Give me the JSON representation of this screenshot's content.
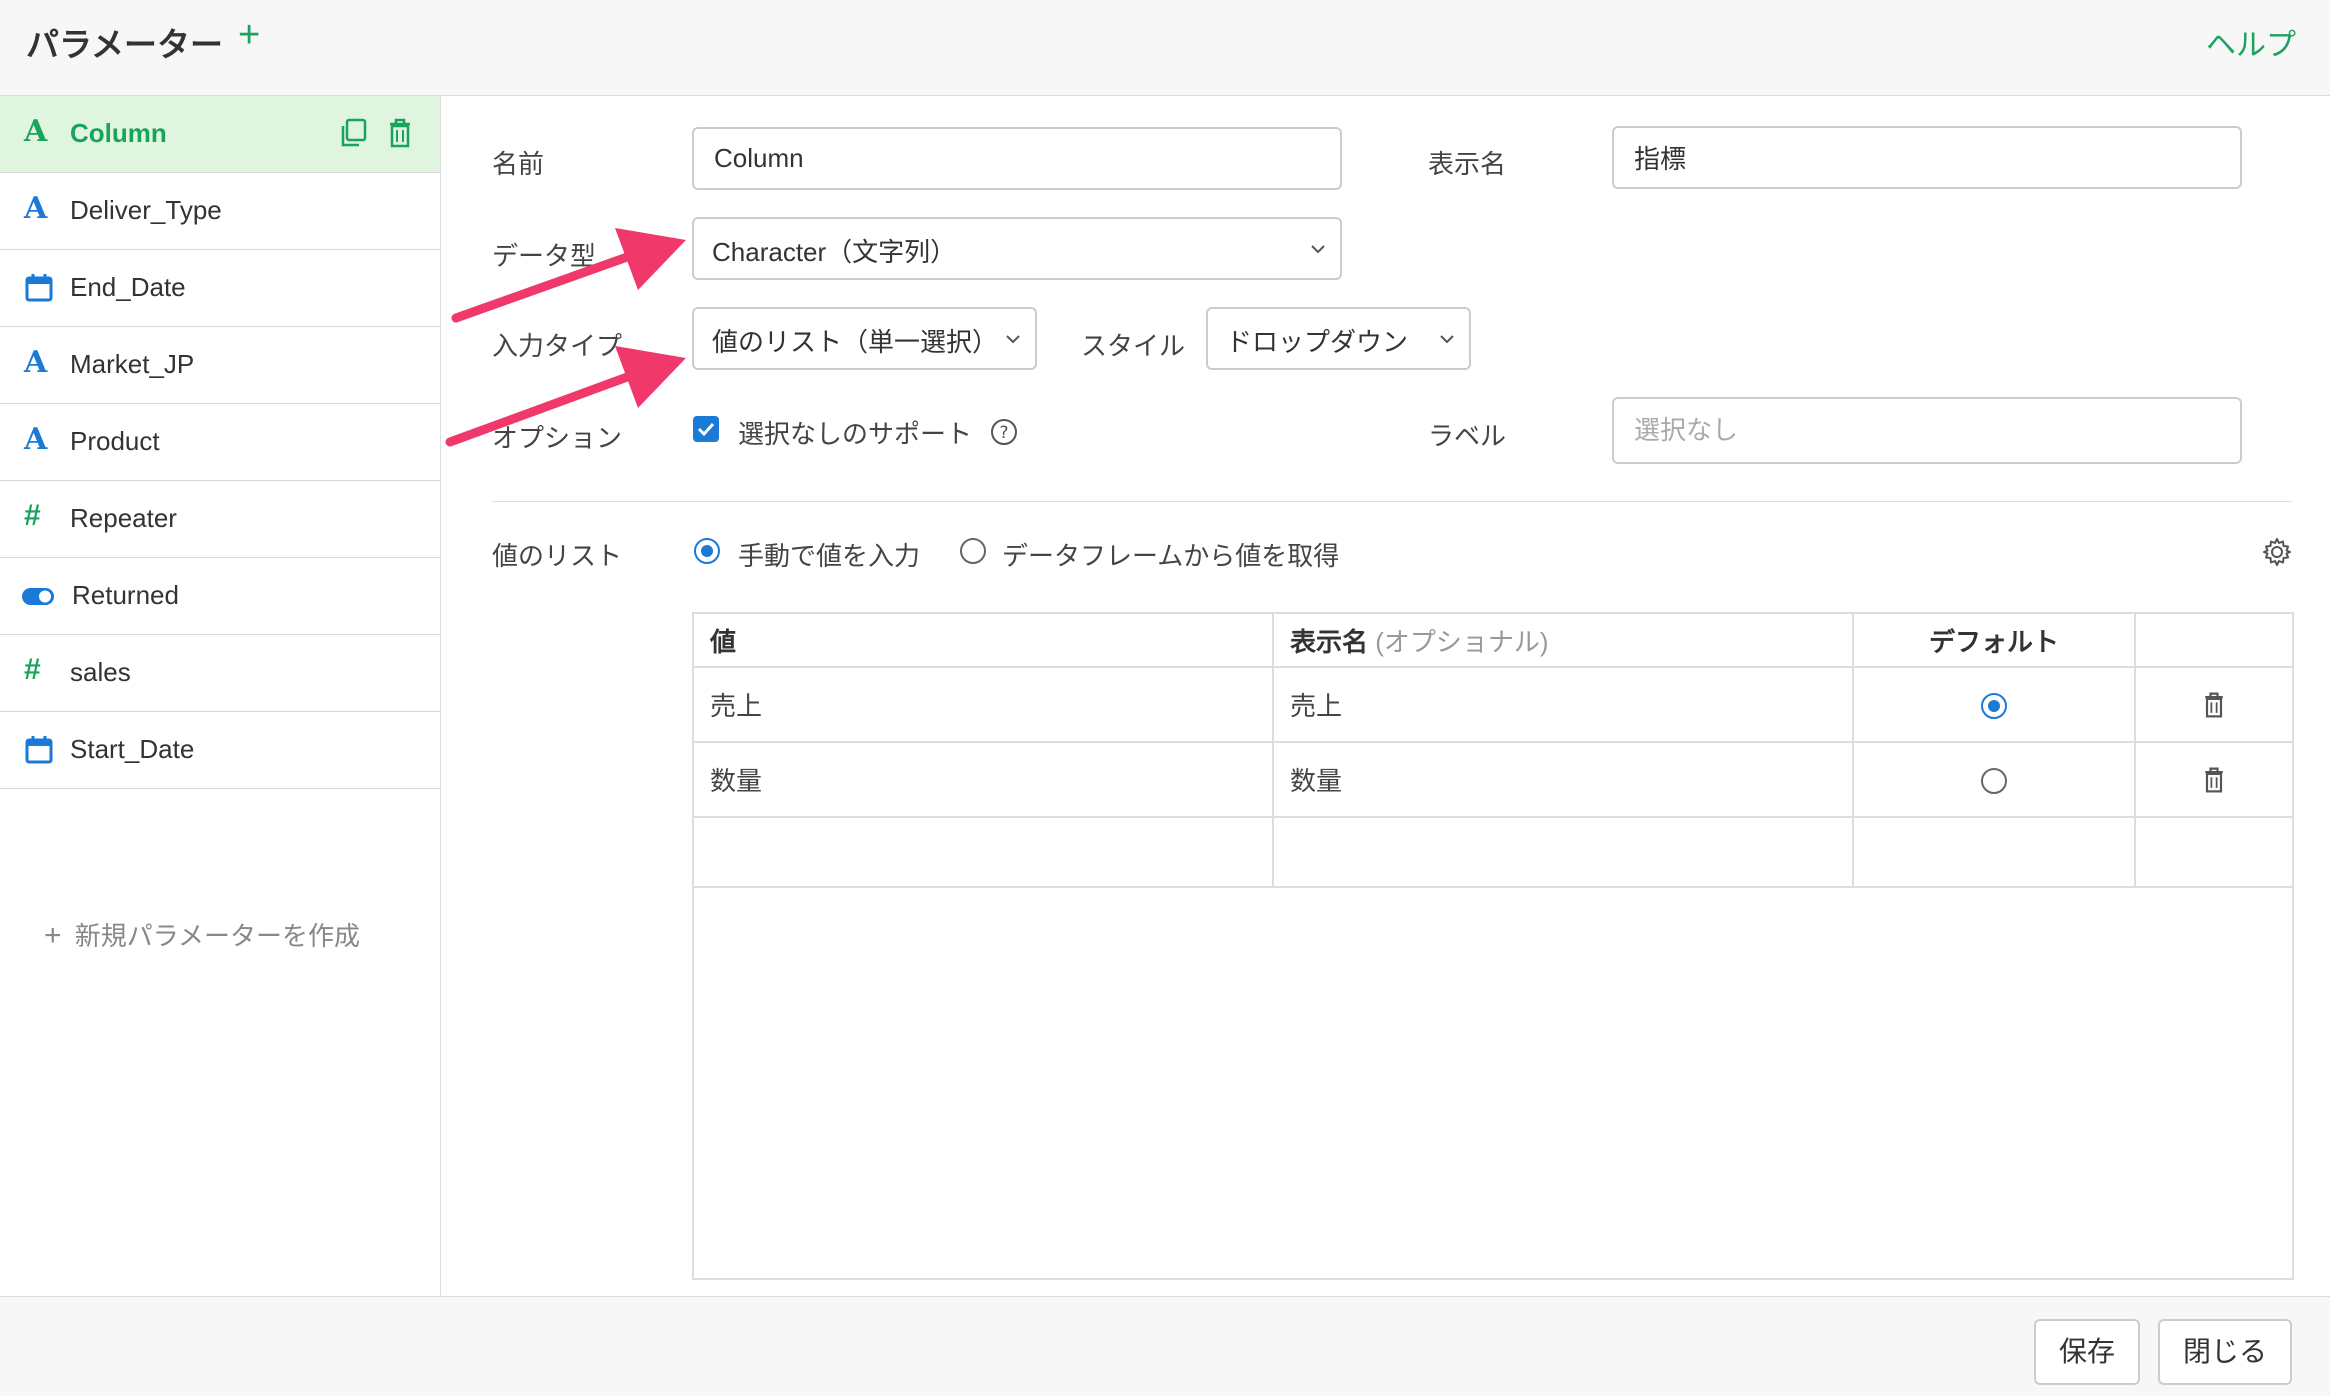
{
  "header": {
    "title": "パラメーター",
    "add_icon": "plus-icon",
    "help": "ヘルプ"
  },
  "sidebar": {
    "items": [
      {
        "icon": "text-type-icon",
        "label": "Column",
        "active": true
      },
      {
        "icon": "text-type-icon",
        "label": "Deliver_Type"
      },
      {
        "icon": "calendar-icon",
        "label": "End_Date"
      },
      {
        "icon": "text-type-icon",
        "label": "Market_JP"
      },
      {
        "icon": "text-type-icon",
        "label": "Product"
      },
      {
        "icon": "number-type-icon",
        "label": "Repeater"
      },
      {
        "icon": "toggle-icon",
        "label": "Returned"
      },
      {
        "icon": "number-type-icon",
        "label": "sales"
      },
      {
        "icon": "calendar-icon",
        "label": "Start_Date"
      }
    ],
    "new_param": "新規パラメーターを作成"
  },
  "form": {
    "name_label": "名前",
    "name_value": "Column",
    "display_name_label": "表示名",
    "display_name_value": "指標",
    "data_type_label": "データ型",
    "data_type_value": "Character（文字列）",
    "input_type_label": "入力タイプ",
    "input_type_value": "値のリスト（単一選択）",
    "style_label": "スタイル",
    "style_value": "ドロップダウン",
    "option_label": "オプション",
    "option_checkbox": "選択なしのサポート",
    "option_checked": true,
    "label_label": "ラベル",
    "label_placeholder": "選択なし"
  },
  "values_list": {
    "label": "値のリスト",
    "radio_manual": "手動で値を入力",
    "radio_dataframe": "データフレームから値を取得",
    "selected": "manual",
    "columns": {
      "value": "値",
      "display": "表示名",
      "display_optional": "(オプショナル)",
      "default": "デフォルト"
    },
    "rows": [
      {
        "value": "売上",
        "display": "売上",
        "default": true
      },
      {
        "value": "数量",
        "display": "数量",
        "default": false
      }
    ]
  },
  "footer": {
    "save": "保存",
    "close": "閉じる"
  },
  "colors": {
    "accent": "#1aa35c",
    "blue": "#1a7ad6",
    "arrow": "#f0386b",
    "active_bg": "#dff5df"
  }
}
